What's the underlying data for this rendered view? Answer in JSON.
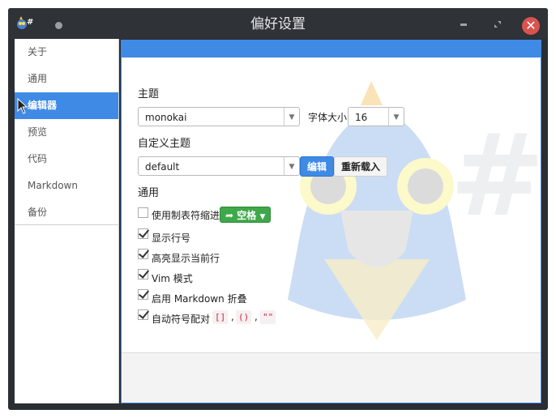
{
  "window": {
    "title": "偏好设置"
  },
  "sidebar": {
    "items": [
      {
        "label": "关于"
      },
      {
        "label": "通用"
      },
      {
        "label": "编辑器"
      },
      {
        "label": "预览"
      },
      {
        "label": "代码"
      },
      {
        "label": "Markdown"
      },
      {
        "label": "备份"
      }
    ],
    "active_index": 2
  },
  "editor": {
    "theme_title": "主题",
    "theme_value": "monokai",
    "font_size_label": "字体大小",
    "font_size_value": "16",
    "custom_theme_title": "自定义主题",
    "custom_theme_value": "default",
    "edit_button": "编辑",
    "reload_button": "重新载入",
    "general_title": "通用",
    "options": [
      {
        "label": "使用制表符缩进",
        "checked": false
      },
      {
        "label": "显示行号",
        "checked": true
      },
      {
        "label": "高亮显示当前行",
        "checked": true
      },
      {
        "label": "Vim 模式",
        "checked": true
      },
      {
        "label": "启用 Markdown 折叠",
        "checked": true
      },
      {
        "label": "自动符号配对",
        "checked": true
      }
    ],
    "indent_button": "空格",
    "pairs": [
      "[]",
      "()",
      "\"\""
    ],
    "pair_separator": ","
  },
  "colors": {
    "accent": "#3f8ae5",
    "success": "#3fa84a",
    "close": "#d9534f"
  }
}
